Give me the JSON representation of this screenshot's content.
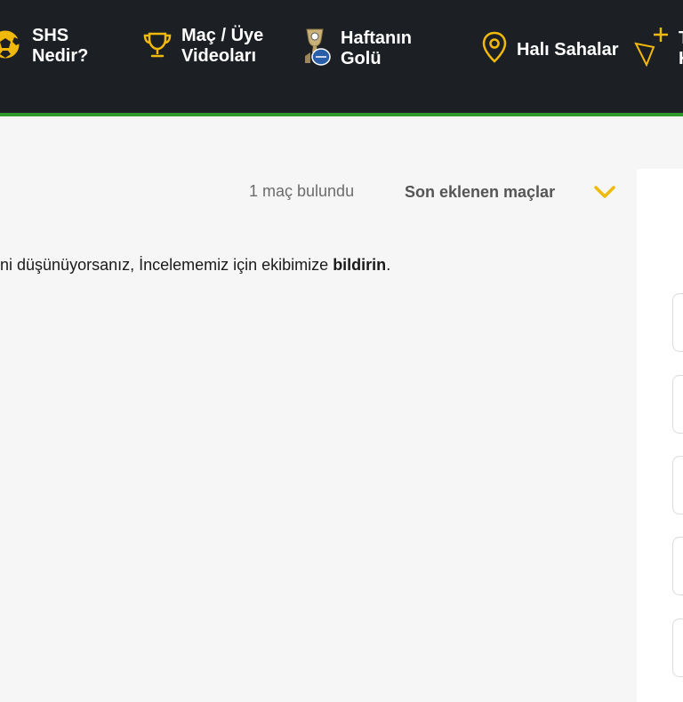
{
  "nav": {
    "items": [
      {
        "id": "shs",
        "label": "SHS\nNedir?",
        "icon": "soccer-ball-icon"
      },
      {
        "id": "videos",
        "label": "Maç / Üye\nVideoları",
        "icon": "trophy-icon"
      },
      {
        "id": "goal",
        "label": "Haftanın\nGolü",
        "icon": "award-cup-icon"
      },
      {
        "id": "pitches",
        "label": "Halı Sahalar",
        "icon": "location-pin-icon"
      },
      {
        "id": "more",
        "label": "T\nK",
        "icon": "location-pin-plus-icon"
      }
    ]
  },
  "results": {
    "count_text": "1 maç bulundu",
    "sort_label": "Son eklenen maçlar"
  },
  "notice": {
    "text": "ni düşünüyorsanız, İncelememiz için ekibimize",
    "link": "bildirin",
    "suffix": "."
  },
  "colors": {
    "header_bg": "#1c1f24",
    "accent_yellow": "#f0b90b",
    "accent_green": "#2f9a2a"
  }
}
